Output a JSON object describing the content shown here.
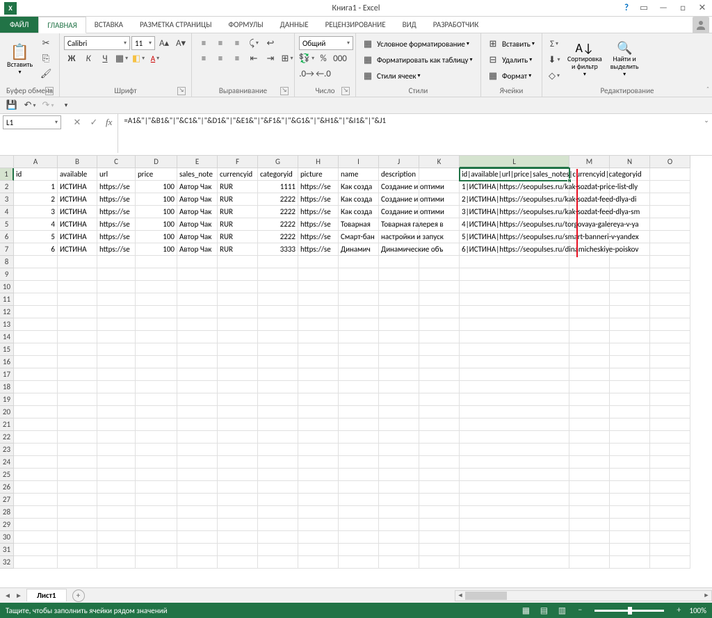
{
  "title": "Книга1 - Excel",
  "tabs": {
    "file": "ФАЙЛ",
    "home": "ГЛАВНАЯ",
    "insert": "ВСТАВКА",
    "pagelayout": "РАЗМЕТКА СТРАНИЦЫ",
    "formulas": "ФОРМУЛЫ",
    "data": "ДАННЫЕ",
    "review": "РЕЦЕНЗИРОВАНИЕ",
    "view": "ВИД",
    "developer": "РАЗРАБОТЧИК"
  },
  "ribbon": {
    "clipboard": {
      "paste": "Вставить",
      "label": "Буфер обмена"
    },
    "font": {
      "name": "Calibri",
      "size": "11",
      "label": "Шрифт"
    },
    "alignment": {
      "label": "Выравнивание"
    },
    "number": {
      "format": "Общий",
      "label": "Число"
    },
    "styles": {
      "cond": "Условное форматирование",
      "table": "Форматировать как таблицу",
      "cell": "Стили ячеек",
      "label": "Стили"
    },
    "cells": {
      "insert": "Вставить",
      "delete": "Удалить",
      "format": "Формат",
      "label": "Ячейки"
    },
    "editing": {
      "sort": "Сортировка\nи фильтр",
      "find": "Найти и\nвыделить",
      "label": "Редактирование"
    }
  },
  "namebox": "L1",
  "formula": "=A1&\"|\"&B1&\"|\"&C1&\"|\"&D1&\"|\"&E1&\"|\"&F1&\"|\"&G1&\"|\"&H1&\"|\"&I1&\"|\"&J1",
  "columns": [
    "A",
    "B",
    "C",
    "D",
    "E",
    "F",
    "G",
    "H",
    "I",
    "J",
    "K",
    "L",
    "M",
    "N",
    "O"
  ],
  "rows": [
    "1",
    "2",
    "3",
    "4",
    "5",
    "6",
    "7",
    "8",
    "9",
    "10",
    "11",
    "12",
    "13",
    "14",
    "15",
    "16",
    "17",
    "18",
    "19",
    "20",
    "21",
    "22",
    "23",
    "24",
    "25",
    "26",
    "27",
    "28",
    "29",
    "30",
    "31",
    "32"
  ],
  "sheet": {
    "r1": {
      "A": "id",
      "B": "available",
      "C": "url",
      "D": "price",
      "E": "sales_note",
      "F": "currencyid",
      "G": "categoryid",
      "H": "picture",
      "I": "name",
      "J": "description",
      "L": "id|available|url|price|sales_notes|currencyid|categoryid"
    },
    "r2": {
      "A": "1",
      "B": "ИСТИНА",
      "C": "https://se",
      "D": "100",
      "E": "Автор Чак",
      "F": "RUR",
      "G": "1111",
      "H": "https://se",
      "I": "Как созда",
      "J": "Создание и оптими",
      "L": "1|ИСТИНА|https://seopulses.ru/kak-sozdat-price-list-dly"
    },
    "r3": {
      "A": "2",
      "B": "ИСТИНА",
      "C": "https://se",
      "D": "100",
      "E": "Автор Чак",
      "F": "RUR",
      "G": "2222",
      "H": "https://se",
      "I": "Как созда",
      "J": "Создание и оптими",
      "L": "2|ИСТИНА|https://seopulses.ru/kak-sozdat-feed-dlya-di"
    },
    "r4": {
      "A": "3",
      "B": "ИСТИНА",
      "C": "https://se",
      "D": "100",
      "E": "Автор Чак",
      "F": "RUR",
      "G": "2222",
      "H": "https://se",
      "I": "Как созда",
      "J": "Создание и оптими",
      "L": "3|ИСТИНА|https://seopulses.ru/kak-sozdat-feed-dlya-sm"
    },
    "r5": {
      "A": "4",
      "B": "ИСТИНА",
      "C": "https://se",
      "D": "100",
      "E": "Автор Чак",
      "F": "RUR",
      "G": "2222",
      "H": "https://se",
      "I": "Товарная",
      "J": "Товарная галерея в",
      "L": "4|ИСТИНА|https://seopulses.ru/torgovaya-galereya-v-ya"
    },
    "r6": {
      "A": "5",
      "B": "ИСТИНА",
      "C": "https://se",
      "D": "100",
      "E": "Автор Чак",
      "F": "RUR",
      "G": "2222",
      "H": "https://se",
      "I": "Смарт-бан",
      "J": "настройки и запуск",
      "L": "5|ИСТИНА|https://seopulses.ru/smart-banneri-v-yandex"
    },
    "r7": {
      "A": "6",
      "B": "ИСТИНА",
      "C": "https://se",
      "D": "100",
      "E": "Автор Чак",
      "F": "RUR",
      "G": "3333",
      "H": "https://se",
      "I": "Динамич",
      "J": "Динамические объ",
      "L": "6|ИСТИНА|https://seopulses.ru/dinamicheskiye-poiskov"
    }
  },
  "sheet_tab": "Лист1",
  "status": "Тащите, чтобы заполнить ячейки рядом значений",
  "zoom": "100%"
}
